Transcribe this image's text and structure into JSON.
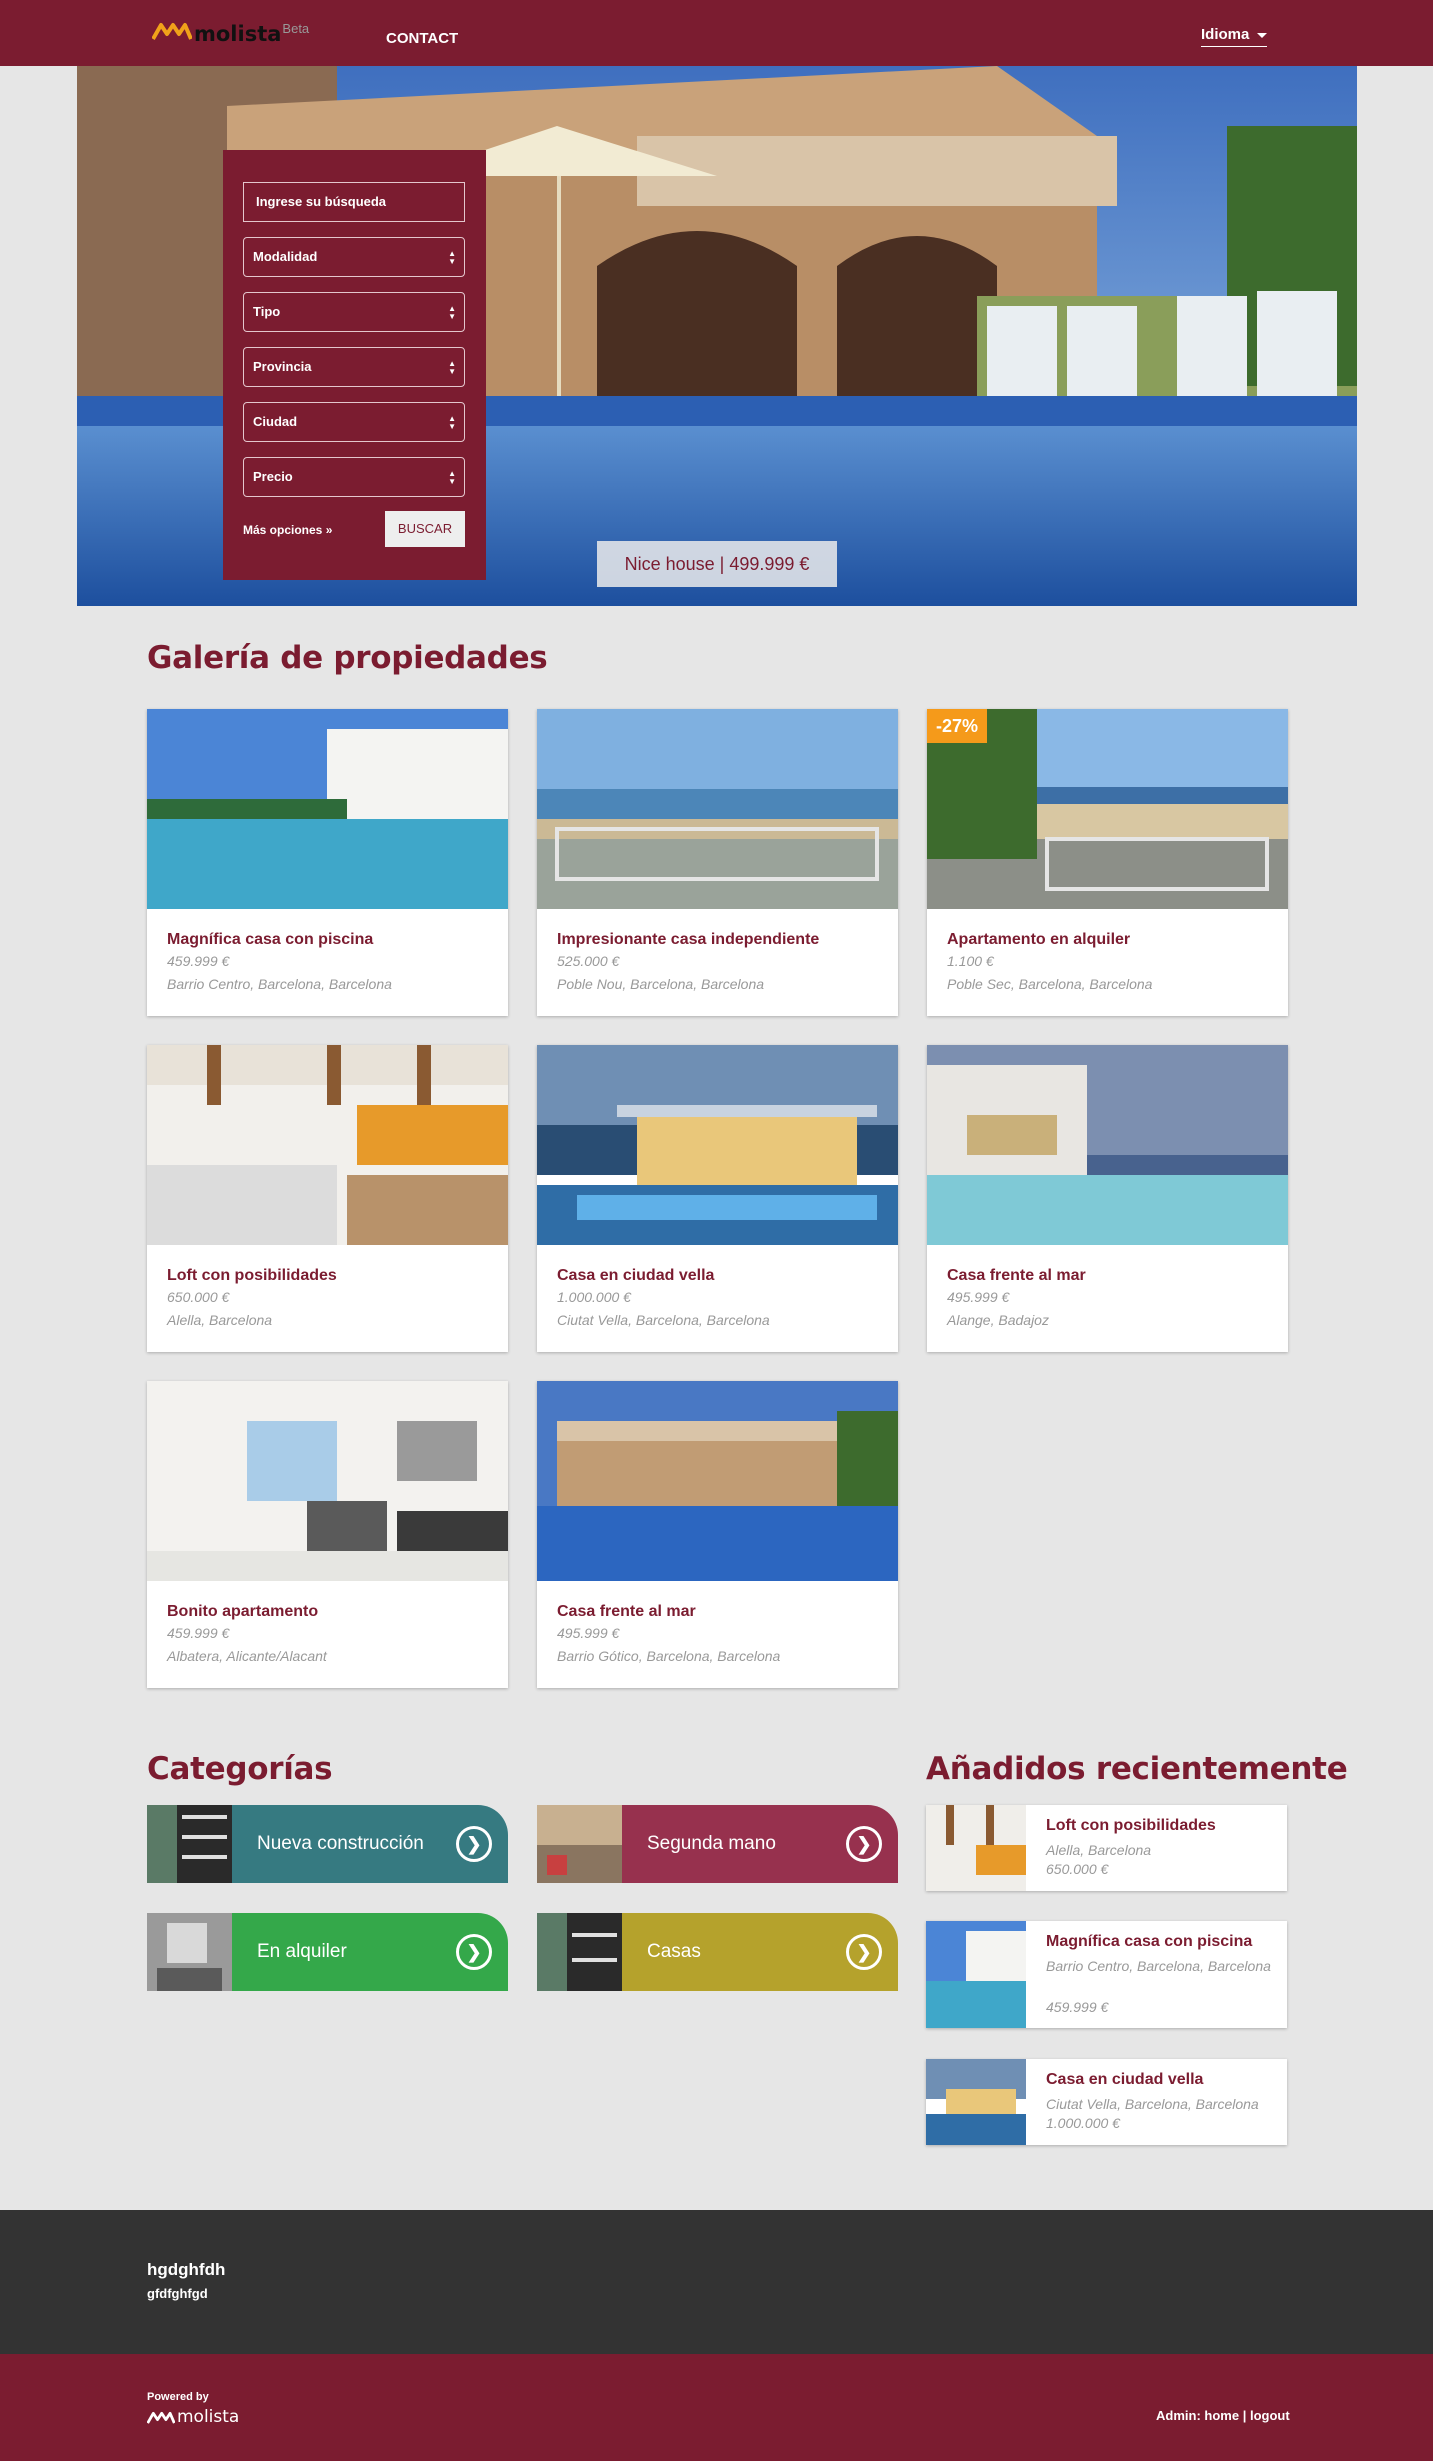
{
  "brand": {
    "name": "molista",
    "badge": "Beta"
  },
  "nav": {
    "contact": "CONTACT",
    "language": "Idioma"
  },
  "search": {
    "query_placeholder": "Ingrese su búsqueda",
    "selects": [
      "Modalidad",
      "Tipo",
      "Provincia",
      "Ciudad",
      "Precio"
    ],
    "more_options": "Más opciones »",
    "submit": "BUSCAR"
  },
  "hero": {
    "caption": "Nice house | 499.999 €"
  },
  "gallery": {
    "title": "Galería de propiedades",
    "items": [
      {
        "title": "Magnífica casa con piscina",
        "price": "459.999 €",
        "location": "Barrio Centro, Barcelona, Barcelona",
        "discount": ""
      },
      {
        "title": "Impresionante casa independiente",
        "price": "525.000 €",
        "location": "Poble Nou, Barcelona, Barcelona",
        "discount": ""
      },
      {
        "title": "Apartamento en alquiler",
        "price": "1.100 €",
        "location": "Poble Sec, Barcelona, Barcelona",
        "discount": "-27%"
      },
      {
        "title": "Loft con posibilidades",
        "price": "650.000 €",
        "location": "Alella, Barcelona",
        "discount": ""
      },
      {
        "title": "Casa en ciudad vella",
        "price": "1.000.000 €",
        "location": "Ciutat Vella, Barcelona, Barcelona",
        "discount": ""
      },
      {
        "title": "Casa frente al mar",
        "price": "495.999 €",
        "location": "Alange, Badajoz",
        "discount": ""
      },
      {
        "title": "Bonito apartamento",
        "price": "459.999 €",
        "location": "Albatera, Alicante/Alacant",
        "discount": ""
      },
      {
        "title": "Casa frente al mar",
        "price": "495.999 €",
        "location": "Barrio Gótico, Barcelona, Barcelona",
        "discount": ""
      }
    ]
  },
  "categories": {
    "title": "Categorías",
    "items": [
      {
        "label": "Nueva construcción",
        "color": "#367a81"
      },
      {
        "label": "Segunda mano",
        "color": "#97314e"
      },
      {
        "label": "En alquiler",
        "color": "#34a84a"
      },
      {
        "label": "Casas",
        "color": "#b5a22c"
      }
    ],
    "arrow": "❯"
  },
  "recent": {
    "title": "Añadidos recientemente",
    "items": [
      {
        "title": "Loft con posibilidades",
        "location": "Alella, Barcelona",
        "price": "650.000 €"
      },
      {
        "title": "Magnífica casa con piscina",
        "location": "Barrio Centro, Barcelona, Barcelona",
        "price": "459.999 €"
      },
      {
        "title": "Casa en ciudad vella",
        "location": "Ciutat Vella, Barcelona, Barcelona",
        "price": "1.000.000 €"
      }
    ]
  },
  "footer": {
    "title": "hgdghfdh",
    "subtitle": "gfdfghfgd",
    "powered_by": "Powered by",
    "powered_brand": "molista",
    "admin_prefix": "Admin:",
    "admin_home": "home",
    "admin_sep": "|",
    "admin_logout": "logout"
  },
  "colors": {
    "brand": "#7b1c30",
    "footer_dark": "#333333",
    "background": "#e6e6e6",
    "discount": "#f59a1a"
  }
}
